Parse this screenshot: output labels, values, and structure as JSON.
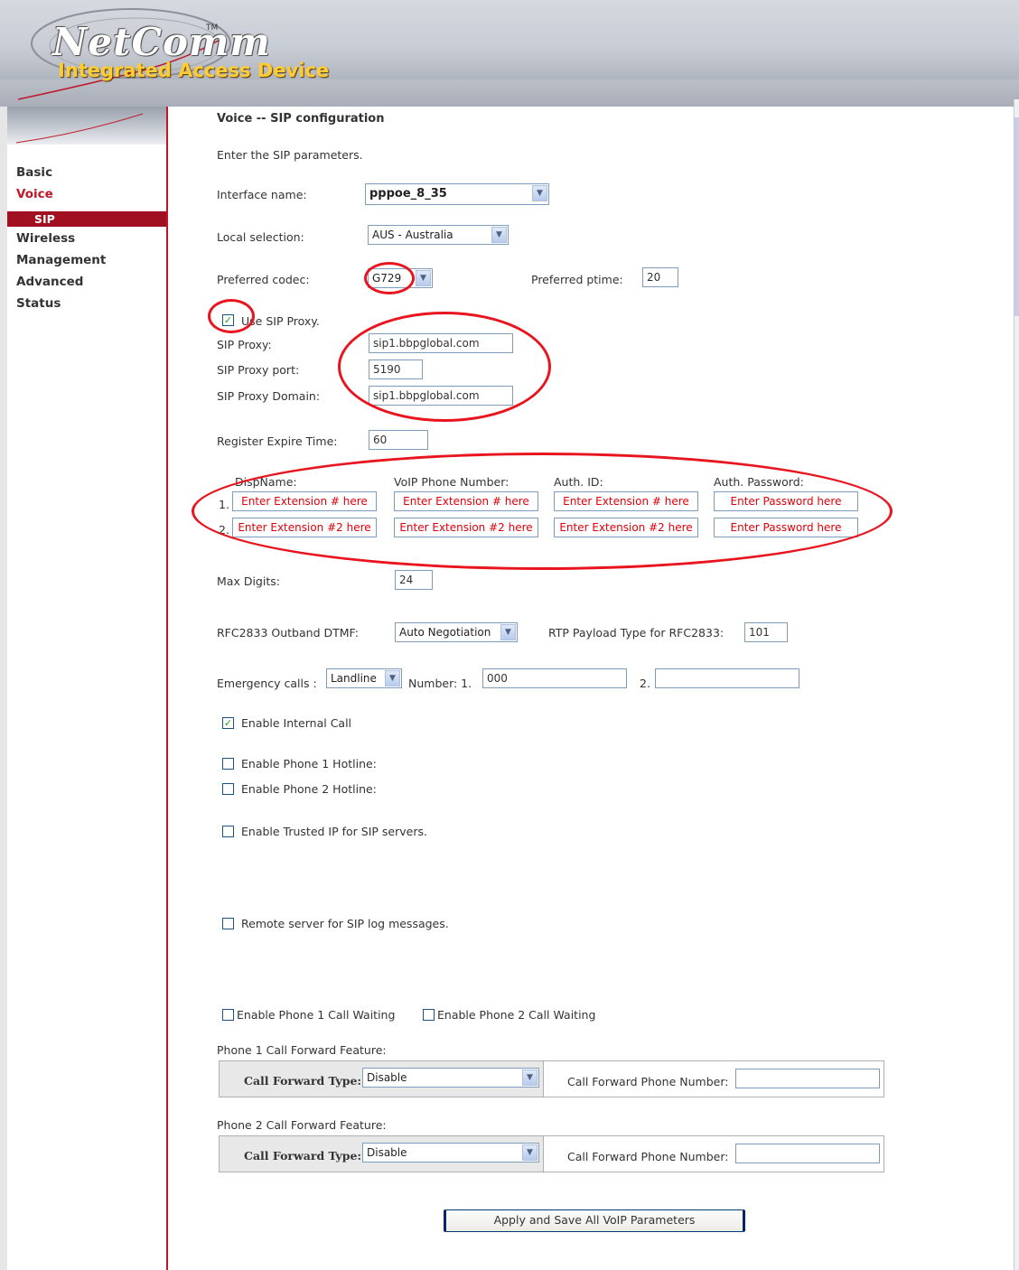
{
  "header": {
    "logo": "NetComm",
    "logo_tm": "TM",
    "product": "Integrated Access Device"
  },
  "sidebar": {
    "items": [
      {
        "label": "Basic"
      },
      {
        "label": "Voice"
      },
      {
        "label": "SIP"
      },
      {
        "label": "Wireless"
      },
      {
        "label": "Management"
      },
      {
        "label": "Advanced"
      },
      {
        "label": "Status"
      }
    ],
    "active": "Voice",
    "selected_sub": "SIP"
  },
  "page": {
    "title": "Voice -- SIP configuration",
    "subtitle": "Enter the SIP parameters.",
    "interface": {
      "label": "Interface name:",
      "value": "pppoe_8_35"
    },
    "locale": {
      "label": "Local selection:",
      "value": "AUS - Australia"
    },
    "codec": {
      "label": "Preferred codec:",
      "value": "G729"
    },
    "ptime": {
      "label": "Preferred ptime:",
      "value": "20"
    },
    "use_proxy": {
      "label": "Use SIP Proxy.",
      "checked": true
    },
    "proxy": {
      "label": "SIP Proxy:",
      "value": "sip1.bbpglobal.com"
    },
    "proxy_port": {
      "label": "SIP Proxy port:",
      "value": "5190"
    },
    "proxy_domain": {
      "label": "SIP Proxy Domain:",
      "value": "sip1.bbpglobal.com"
    },
    "expire": {
      "label": "Register Expire Time:",
      "value": "60"
    },
    "accounts": {
      "headers": [
        "DispName:",
        "VoIP Phone Number:",
        "Auth. ID:",
        "Auth. Password:"
      ],
      "rows": [
        {
          "num": "1.",
          "disp": "Enter Extension # here",
          "phone": "Enter Extension # here",
          "auth_id": "Enter Extension # here",
          "password": "Enter Password here"
        },
        {
          "num": "2.",
          "disp": "Enter Extension #2 here",
          "phone": "Enter Extension #2 here",
          "auth_id": "Enter Extension #2 here",
          "password": "Enter Password here"
        }
      ]
    },
    "max_digits": {
      "label": "Max Digits:",
      "value": "24"
    },
    "dtmf": {
      "label": "RFC2833 Outband DTMF:",
      "value": "Auto Negotiation"
    },
    "payload": {
      "label": "RTP Payload Type for RFC2833:",
      "value": "101"
    },
    "emergency": {
      "label": "Emergency calls :",
      "type": "Landline",
      "number_label": "Number: 1.",
      "number1": "000",
      "label2": "2.",
      "number2": ""
    },
    "internal_call": {
      "label": "Enable Internal Call",
      "checked": true
    },
    "hotline1": {
      "label": "Enable Phone 1 Hotline:",
      "checked": false
    },
    "hotline2": {
      "label": "Enable Phone 2 Hotline:",
      "checked": false
    },
    "trusted_ip": {
      "label": "Enable Trusted IP for SIP servers.",
      "checked": false
    },
    "remote_log": {
      "label": "Remote server for SIP log messages.",
      "checked": false
    },
    "call_waiting1": {
      "label": "Enable Phone 1 Call Waiting",
      "checked": false
    },
    "call_waiting2": {
      "label": "Enable Phone 2 Call Waiting",
      "checked": false
    },
    "forward1": {
      "section": "Phone 1 Call Forward Feature:",
      "type_label": "Call Forward Type:",
      "type_value": "Disable",
      "number_label": "Call Forward Phone Number:",
      "number_value": ""
    },
    "forward2": {
      "section": "Phone 2 Call Forward Feature:",
      "type_label": "Call Forward Type:",
      "type_value": "Disable",
      "number_label": "Call Forward Phone Number:",
      "number_value": ""
    },
    "apply_label": "Apply and Save All VoIP Parameters"
  },
  "colors": {
    "brand_red": "#c0182a",
    "annotation_red": "#e8141e",
    "placeholder_red": "#e0000a",
    "accent_gold": "#ffcc33"
  }
}
